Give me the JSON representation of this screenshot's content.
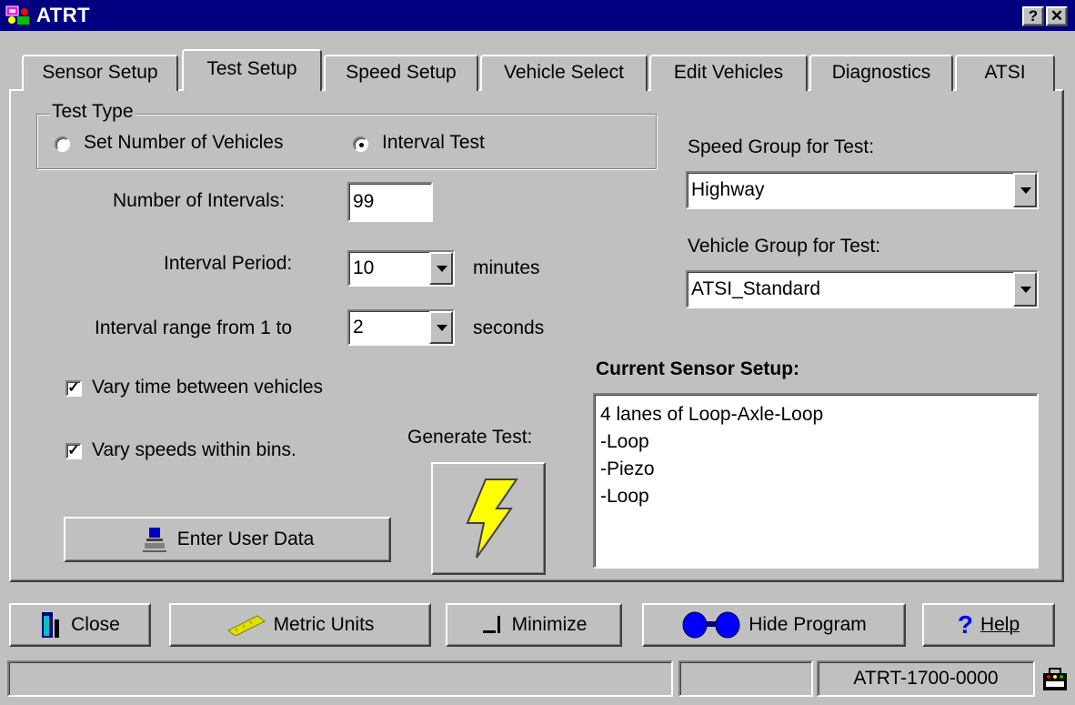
{
  "window": {
    "title": "ATRT",
    "help_btn": "?",
    "close_btn": "✕"
  },
  "tabs": [
    "Sensor Setup",
    "Test Setup",
    "Speed Setup",
    "Vehicle Select",
    "Edit Vehicles",
    "Diagnostics",
    "ATSI"
  ],
  "active_tab": "Test Setup",
  "test_type": {
    "label": "Test Type",
    "options": [
      "Set Number of Vehicles",
      "Interval Test"
    ],
    "selected": "Interval Test"
  },
  "number_of_intervals": {
    "label": "Number of Intervals:",
    "value": "99"
  },
  "interval_period": {
    "label": "Interval Period:",
    "value": "10",
    "unit": "minutes"
  },
  "interval_range": {
    "label": "Interval range from 1 to",
    "value": "2",
    "unit": "seconds"
  },
  "options": {
    "vary_time": {
      "label": "Vary time between vehicles",
      "checked": true,
      "mark": "✓"
    },
    "vary_speeds": {
      "label": "Vary speeds within bins.",
      "checked": true,
      "mark": "✓"
    }
  },
  "enter_user_data_label": "Enter User Data",
  "generate_test_label": "Generate Test:",
  "speed_group": {
    "label": "Speed Group for Test:",
    "value": "Highway"
  },
  "vehicle_group": {
    "label": "Vehicle Group for Test:",
    "value": "ATSI_Standard"
  },
  "current_sensor_setup": {
    "label": "Current Sensor Setup:",
    "lines": [
      "4 lanes of Loop-Axle-Loop",
      " -Loop",
      " -Piezo",
      " -Loop"
    ]
  },
  "bottom_buttons": {
    "close": "Close",
    "metric": "Metric Units",
    "minimize": "Minimize",
    "hide": "Hide Program",
    "help": "Help"
  },
  "status_bar": {
    "device": "ATRT-1700-0000"
  },
  "icons": [
    "app-icon",
    "exit-door-icon",
    "ruler-icon",
    "minimize-icon",
    "binoculars-icon",
    "question-icon",
    "lightning-icon",
    "user-data-icon",
    "atsi-logo-icon"
  ]
}
